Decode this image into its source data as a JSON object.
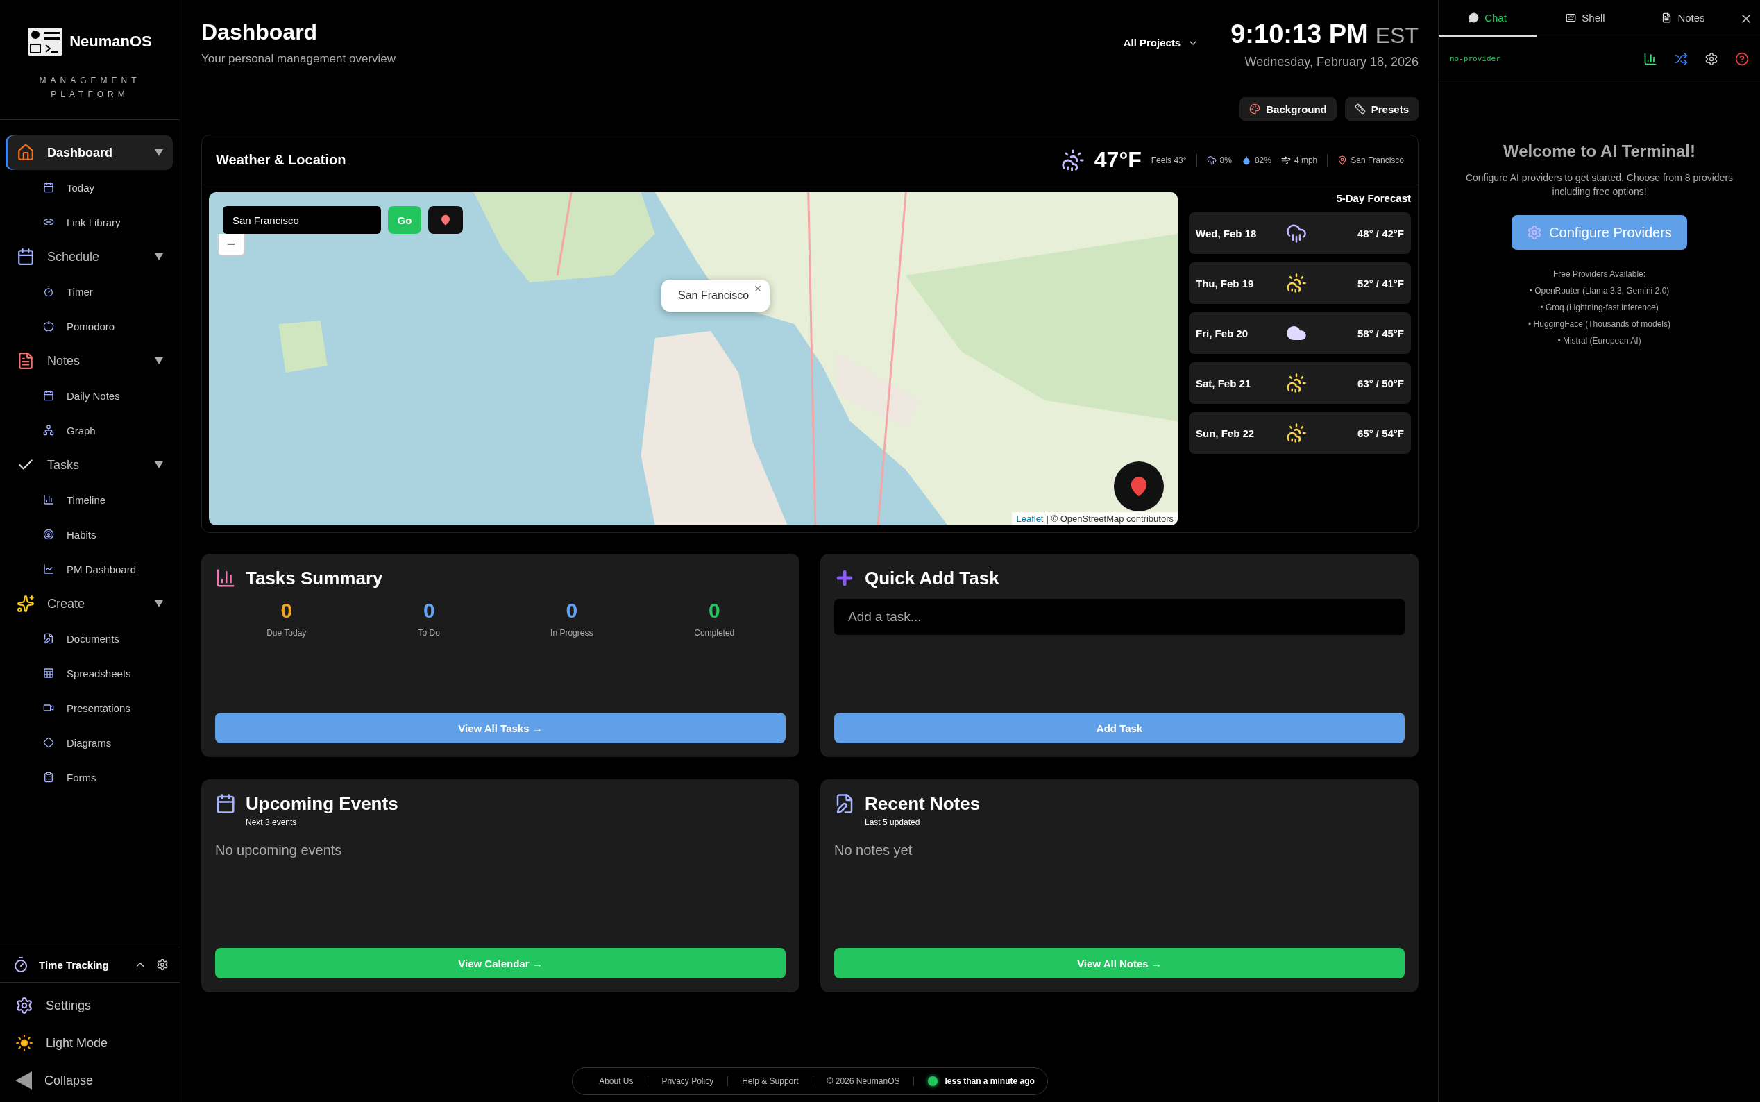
{
  "sidebar": {
    "brand": {
      "name": "NeumanOS",
      "subtitle": "MANAGEMENT PLATFORM"
    },
    "nav": [
      {
        "label": "Dashboard",
        "selected": true,
        "expanded": true,
        "children": [
          {
            "label": "Today"
          },
          {
            "label": "Link Library"
          }
        ]
      },
      {
        "label": "Schedule",
        "selected": false,
        "expanded": true,
        "children": [
          {
            "label": "Timer"
          },
          {
            "label": "Pomodoro"
          }
        ]
      },
      {
        "label": "Notes",
        "selected": false,
        "expanded": true,
        "children": [
          {
            "label": "Daily Notes"
          },
          {
            "label": "Graph"
          }
        ]
      },
      {
        "label": "Tasks",
        "selected": false,
        "expanded": true,
        "children": [
          {
            "label": "Timeline"
          },
          {
            "label": "Habits"
          },
          {
            "label": "PM Dashboard"
          }
        ]
      },
      {
        "label": "Create",
        "selected": false,
        "expanded": true,
        "children": [
          {
            "label": "Documents"
          },
          {
            "label": "Spreadsheets"
          },
          {
            "label": "Presentations"
          },
          {
            "label": "Diagrams"
          },
          {
            "label": "Forms"
          }
        ]
      }
    ],
    "time_tracking": {
      "label": "Time Tracking",
      "expanded": true
    },
    "bottom_items": [
      {
        "label": "Settings"
      },
      {
        "label": "Light Mode"
      },
      {
        "label": "Collapse"
      }
    ]
  },
  "header": {
    "title": "Dashboard",
    "subtitle": "Your personal management overview",
    "project_filter": "All Projects",
    "clock": {
      "time": "9:10:13 PM",
      "zone": "EST",
      "date": "Wednesday, February 18, 2026"
    },
    "buttons": [
      "Background",
      "Presets"
    ]
  },
  "weather": {
    "title": "Weather & Location",
    "current": {
      "temp": "47°F",
      "feels": "Feels 43°",
      "precip": "8%",
      "humidity": "82%",
      "wind": "4 mph",
      "location": "San Francisco"
    },
    "map": {
      "search_value": "San Francisco",
      "go": "Go",
      "popup": "San Francisco",
      "popup_close": "×",
      "zoom_out": "−",
      "attribution_link": "Leaflet",
      "attribution": "| © OpenStreetMap contributors"
    },
    "forecast": {
      "title": "5-Day Forecast",
      "days": [
        {
          "day": "Wed, Feb 18",
          "kind": "rain",
          "temps": "48° / 42°F"
        },
        {
          "day": "Thu, Feb 19",
          "kind": "sun-rain",
          "temps": "52° / 41°F"
        },
        {
          "day": "Fri, Feb 20",
          "kind": "cloud",
          "temps": "58° / 45°F"
        },
        {
          "day": "Sat, Feb 21",
          "kind": "sun-rain",
          "temps": "63° / 50°F"
        },
        {
          "day": "Sun, Feb 22",
          "kind": "sun-rain",
          "temps": "65° / 54°F"
        }
      ]
    }
  },
  "tasks_summary": {
    "title": "Tasks Summary",
    "stats": [
      {
        "value": "0",
        "label": "Due Today",
        "color": "#f5a524"
      },
      {
        "value": "0",
        "label": "To Do",
        "color": "#60a5fa"
      },
      {
        "value": "0",
        "label": "In Progress",
        "color": "#60a5fa"
      },
      {
        "value": "0",
        "label": "Completed",
        "color": "#22c55e"
      }
    ],
    "button": "View All Tasks →"
  },
  "quick_add": {
    "title": "Quick Add Task",
    "placeholder": "Add a task...",
    "button": "Add Task"
  },
  "events": {
    "title": "Upcoming Events",
    "subtitle": "Next 3 events",
    "empty": "No upcoming events",
    "button": "View Calendar →"
  },
  "recent_notes": {
    "title": "Recent Notes",
    "subtitle": "Last 5 updated",
    "empty": "No notes yet",
    "button": "View All Notes →"
  },
  "footer": {
    "links": [
      "About Us",
      "Privacy Policy",
      "Help & Support"
    ],
    "copyright": "© 2026 NeumanOS",
    "status": "less than a minute ago"
  },
  "ai_panel": {
    "tabs": [
      {
        "label": "Chat",
        "selected": true
      },
      {
        "label": "Shell",
        "selected": false
      },
      {
        "label": "Notes",
        "selected": false
      }
    ],
    "provider": "no-provider",
    "title": "Welcome to AI Terminal!",
    "description": "Configure AI providers to get started. Choose from 8 providers including free options!",
    "button": "Configure Providers",
    "free_title": "Free Providers Available:",
    "providers": [
      "• OpenRouter (Llama 3.3, Gemini 2.0)",
      "• Groq (Lightning-fast inference)",
      "• HuggingFace (Thousands of models)",
      "• Mistral (European AI)"
    ]
  }
}
